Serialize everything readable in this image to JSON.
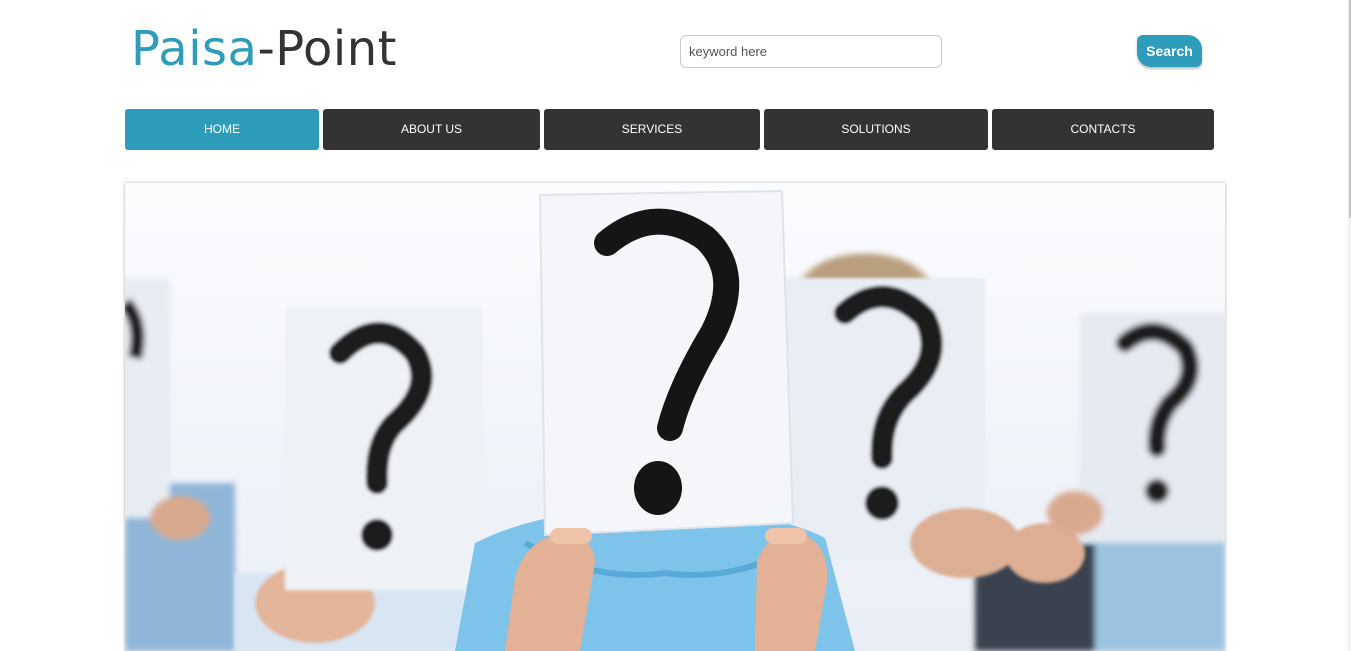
{
  "logo": {
    "part1": "Paisa",
    "part2": "-Point"
  },
  "search": {
    "placeholder": "keyword here",
    "button_label": "Search"
  },
  "nav": {
    "items": [
      {
        "label": "HOME",
        "active": true
      },
      {
        "label": "ABOUT US",
        "active": false
      },
      {
        "label": "SERVICES",
        "active": false
      },
      {
        "label": "SOLUTIONS",
        "active": false
      },
      {
        "label": "CONTACTS",
        "active": false
      }
    ]
  },
  "banner": {
    "image_subject": "people holding question mark signs"
  },
  "colors": {
    "accent": "#2e9dbb",
    "nav_bg": "#333333",
    "logo_dark": "#333333"
  }
}
